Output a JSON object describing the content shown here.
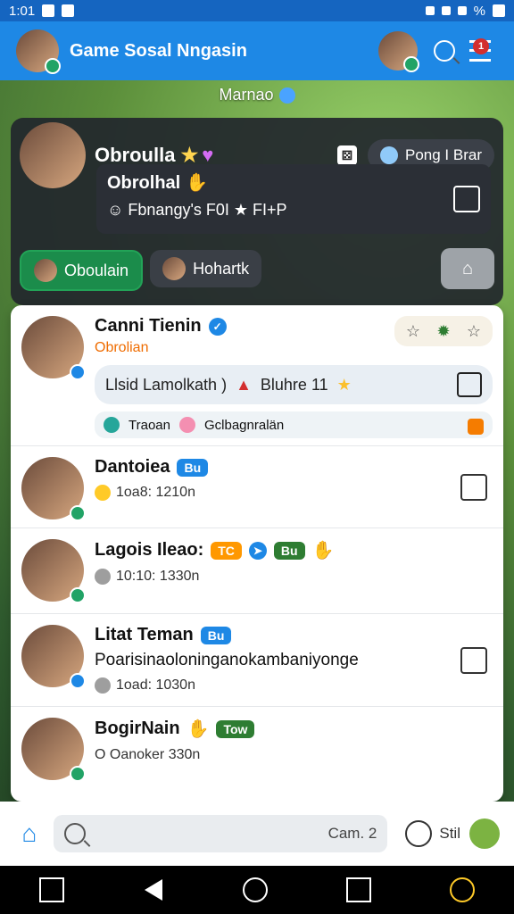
{
  "status_bar": {
    "time": "1:01",
    "battery_text": "%"
  },
  "appbar": {
    "title": "Game Sosal Nngasin",
    "notification_count": "1"
  },
  "top_label": {
    "text": "Marnao"
  },
  "hero": {
    "name": "Obroulla",
    "game_pill_label": "Pong I Brar",
    "status_line1": "Obrolhal",
    "status_line2": "Fbnangy's F0I ★ FI+P",
    "tabs": [
      {
        "label": "Oboulain",
        "active": true
      },
      {
        "label": "Hohartk",
        "active": false
      }
    ]
  },
  "list": {
    "items": [
      {
        "name": "Canni Tienin",
        "subname": "Obrolian",
        "message": "Llsid Lamolkath ) ",
        "message_tail": "Bluhre 11",
        "reactions": [
          {
            "label": "Traoan"
          },
          {
            "label": "Gclbagnralän"
          }
        ]
      },
      {
        "name": "Dantoiea",
        "chip": "Bu",
        "meta": "1oa8: 1210n"
      },
      {
        "name": "Lagois Ileao:",
        "chips": [
          "TC",
          "Bu"
        ],
        "meta": "10:10: 1330n"
      },
      {
        "name": "Litat Teman",
        "chip": "Bu",
        "line2": "Poarisinaoloninganokambaniyonge",
        "meta": "1oad: 1030n"
      },
      {
        "name": "BogirNain",
        "chip": "Tow",
        "meta": "O Oanoker 330n"
      }
    ]
  },
  "bottom_nav": {
    "search_placeholder": "Cam. 2",
    "chat_label": "Stil"
  }
}
